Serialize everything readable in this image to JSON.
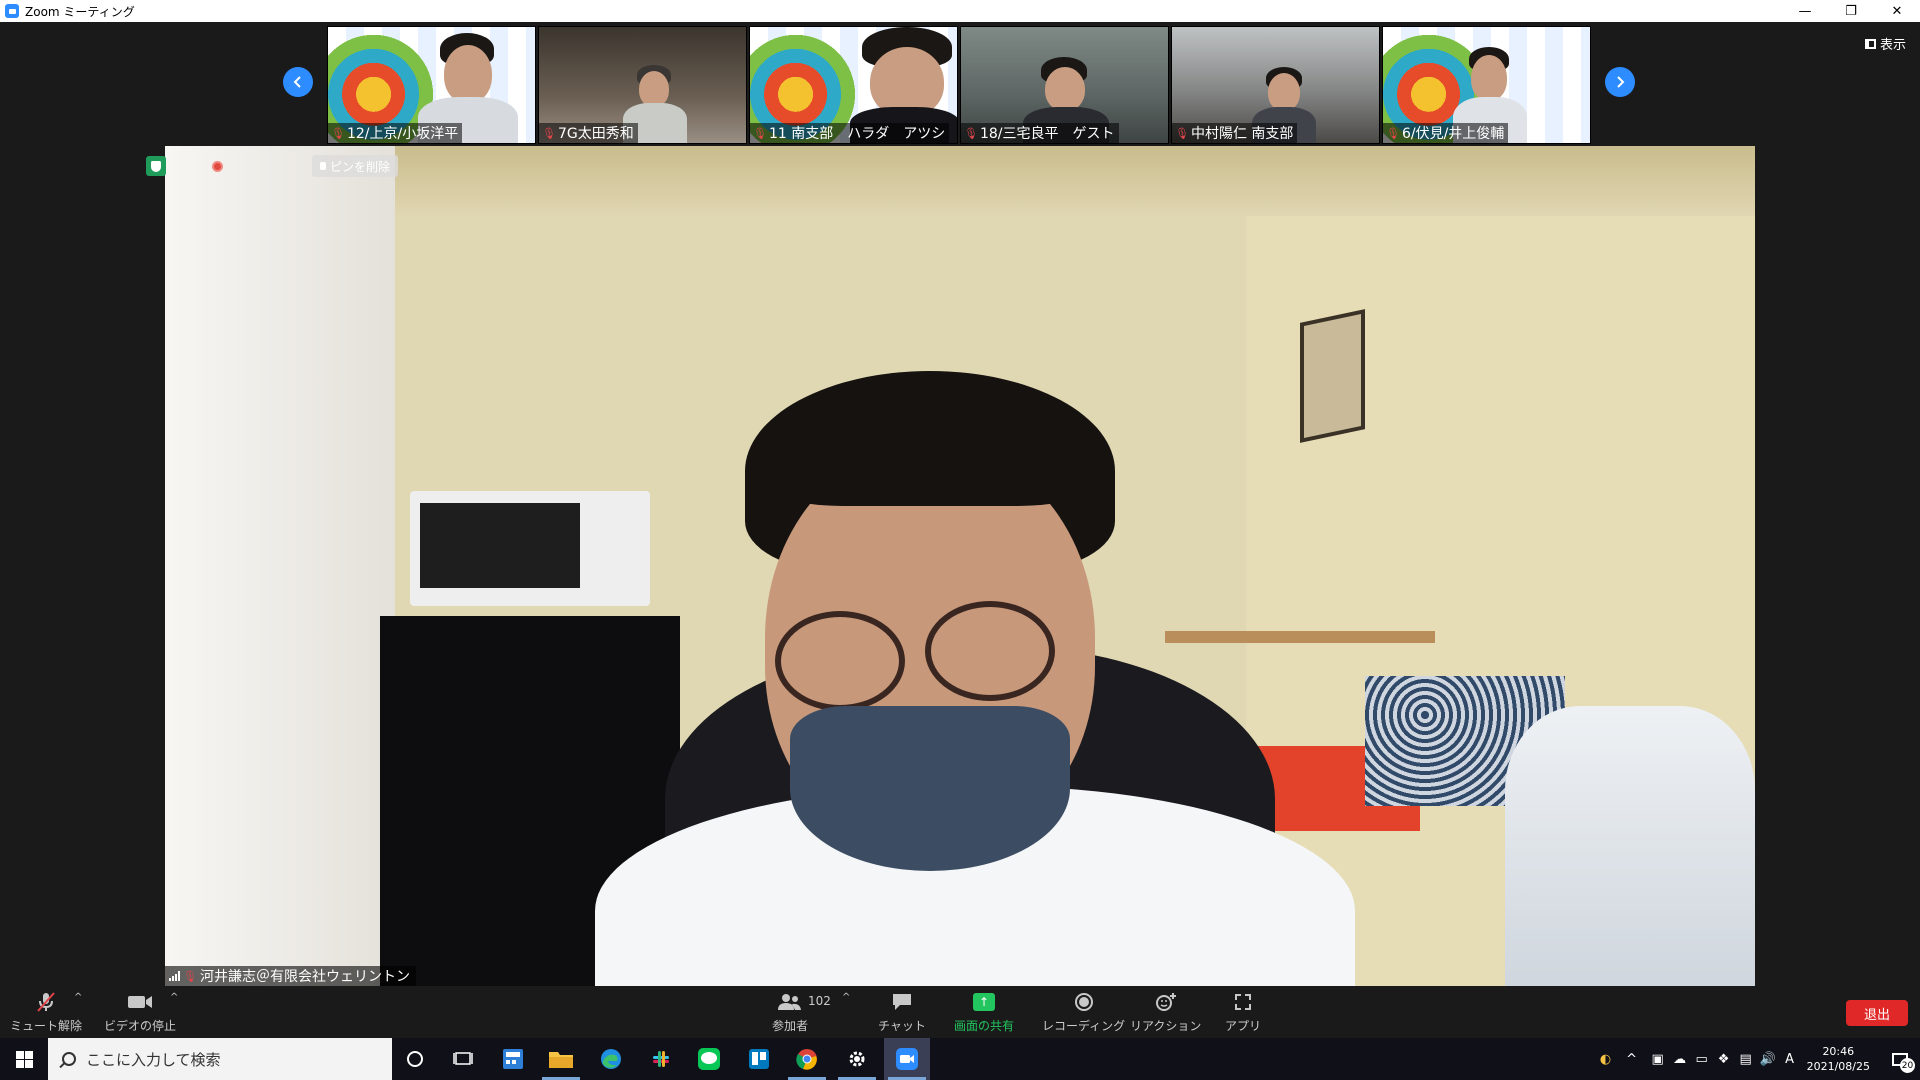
{
  "window": {
    "title": "Zoom ミーティング",
    "minimize": "—",
    "restore": "❐",
    "close": "✕"
  },
  "gallery": {
    "view_label": "表示",
    "participants": [
      {
        "name": "12/上京/小坂洋平"
      },
      {
        "name": "7G太田秀和"
      },
      {
        "name": "11 南支部　ハラダ　アツシ"
      },
      {
        "name": "18/三宅良平　ゲスト"
      },
      {
        "name": "中村陽仁 南支部"
      },
      {
        "name": "6/伏見/井上俊輔"
      }
    ]
  },
  "main": {
    "unpin_label": "ピンを削除",
    "speaker_name": "河井謙志＠有限会社ウェリントン"
  },
  "toolbar": {
    "unmute": "ミュート解除",
    "stop_video": "ビデオの停止",
    "participants": "参加者",
    "participant_count": "102",
    "chat": "チャット",
    "share_screen": "画面の共有",
    "recording": "レコーディング",
    "reactions": "リアクション",
    "apps": "アプリ",
    "leave": "退出"
  },
  "taskbar": {
    "search_placeholder": "ここに入力して検索",
    "time": "20:46",
    "date": "2021/08/25",
    "ime": "A",
    "notification_count": "20"
  },
  "colors": {
    "accent": "#2d8cff",
    "leave": "#e02828",
    "share": "#22c55e",
    "muted_mic": "#e0454a"
  }
}
